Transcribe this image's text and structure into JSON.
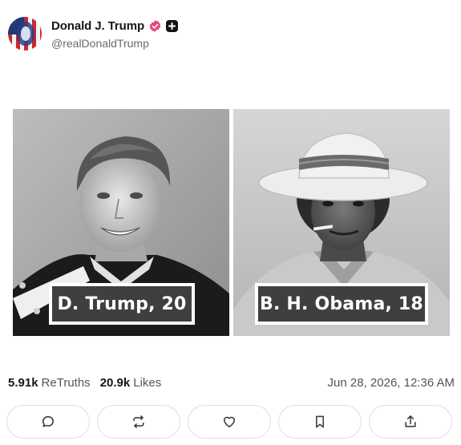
{
  "post": {
    "author": {
      "display_name": "Donald J. Trump",
      "handle": "@realDonaldTrump",
      "avatar_icon": "avatar-flag-portrait",
      "verified_icon": "verified-badge-icon",
      "verified_color": "#e6487a",
      "plus_icon": "plus-badge-icon"
    },
    "media": {
      "left_caption": "D. Trump, 20",
      "right_caption": "B. H. Obama, 18"
    },
    "stats": {
      "retruths_count": "5.91k",
      "retruths_label": "ReTruths",
      "likes_count": "20.9k",
      "likes_label": "Likes"
    },
    "timestamp": "Jun 28, 2026, 12:36 AM",
    "actions": [
      {
        "name": "reply",
        "icon": "comment-icon"
      },
      {
        "name": "retruth",
        "icon": "repost-icon"
      },
      {
        "name": "like",
        "icon": "heart-icon"
      },
      {
        "name": "bookmark",
        "icon": "bookmark-icon"
      },
      {
        "name": "share",
        "icon": "share-icon"
      }
    ]
  }
}
